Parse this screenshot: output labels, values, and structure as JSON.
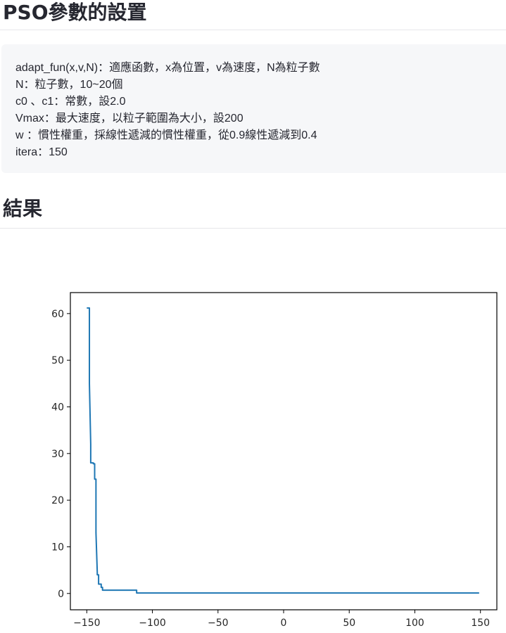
{
  "header": {
    "title": "PSO參數的設置"
  },
  "params": {
    "lines": [
      "adapt_fun(x,v,N)：適應函數，x為位置，v為速度，N為粒子數",
      "N：粒子數，10~20個",
      "c0 、c1：常數，設2.0",
      "Vmax：最大速度，以粒子範圍為大小，設200",
      "w ：慣性權重，採線性遞減的慣性權重，從0.9線性遞減到0.4",
      "itera：150"
    ]
  },
  "results": {
    "title": "結果"
  },
  "chart_data": {
    "type": "line",
    "title": "",
    "xlabel": "",
    "ylabel": "",
    "xlim": [
      -162.5,
      162.5
    ],
    "ylim": [
      -3.5,
      64.5
    ],
    "xticks": [
      -150,
      -100,
      -50,
      0,
      50,
      100,
      150
    ],
    "yticks": [
      0,
      10,
      20,
      30,
      40,
      50,
      60
    ],
    "xtick_labels": [
      "−150",
      "−100",
      "−50",
      "0",
      "50",
      "100",
      "150"
    ],
    "ytick_labels": [
      "0",
      "10",
      "20",
      "30",
      "40",
      "50",
      "60"
    ],
    "grid": false,
    "legend": "none",
    "series": [
      {
        "color": "#1f77b4",
        "x": [
          -150,
          -148,
          -148,
          -147,
          -147,
          -145,
          -145,
          -144,
          -144,
          -143,
          -143,
          -142,
          -142,
          -141,
          -141,
          -140,
          -140,
          -139,
          -139,
          -138,
          -138,
          -137,
          -137,
          -112,
          -112,
          149
        ],
        "y": [
          61.2,
          61.2,
          45,
          32,
          28,
          28,
          27.8,
          27.8,
          24.5,
          24.5,
          13,
          4.5,
          4,
          4,
          2,
          2,
          2,
          2,
          1.3,
          1.3,
          0.7,
          0.7,
          0.7,
          0.7,
          0.1,
          0.1
        ]
      }
    ]
  }
}
